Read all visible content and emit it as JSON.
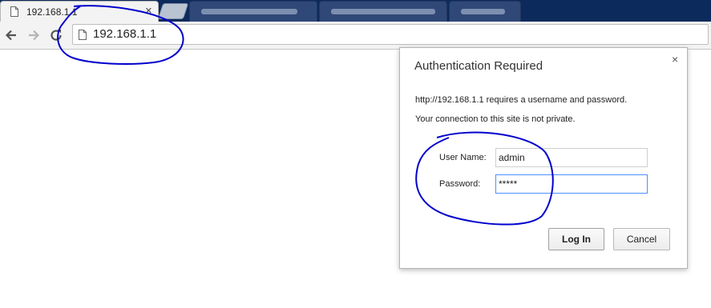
{
  "browser": {
    "tab_title": "192.168.1.1",
    "tab_close": "×",
    "url": "192.168.1.1"
  },
  "auth_dialog": {
    "title": "Authentication Required",
    "close": "×",
    "message": "http://192.168.1.1 requires a username and password.",
    "warning": "Your connection to this site is not private.",
    "username_label": "User Name:",
    "username_value": "admin",
    "password_label": "Password:",
    "password_value": "*****",
    "login_button": "Log In",
    "cancel_button": "Cancel"
  },
  "annotation_color": "#0000cc"
}
